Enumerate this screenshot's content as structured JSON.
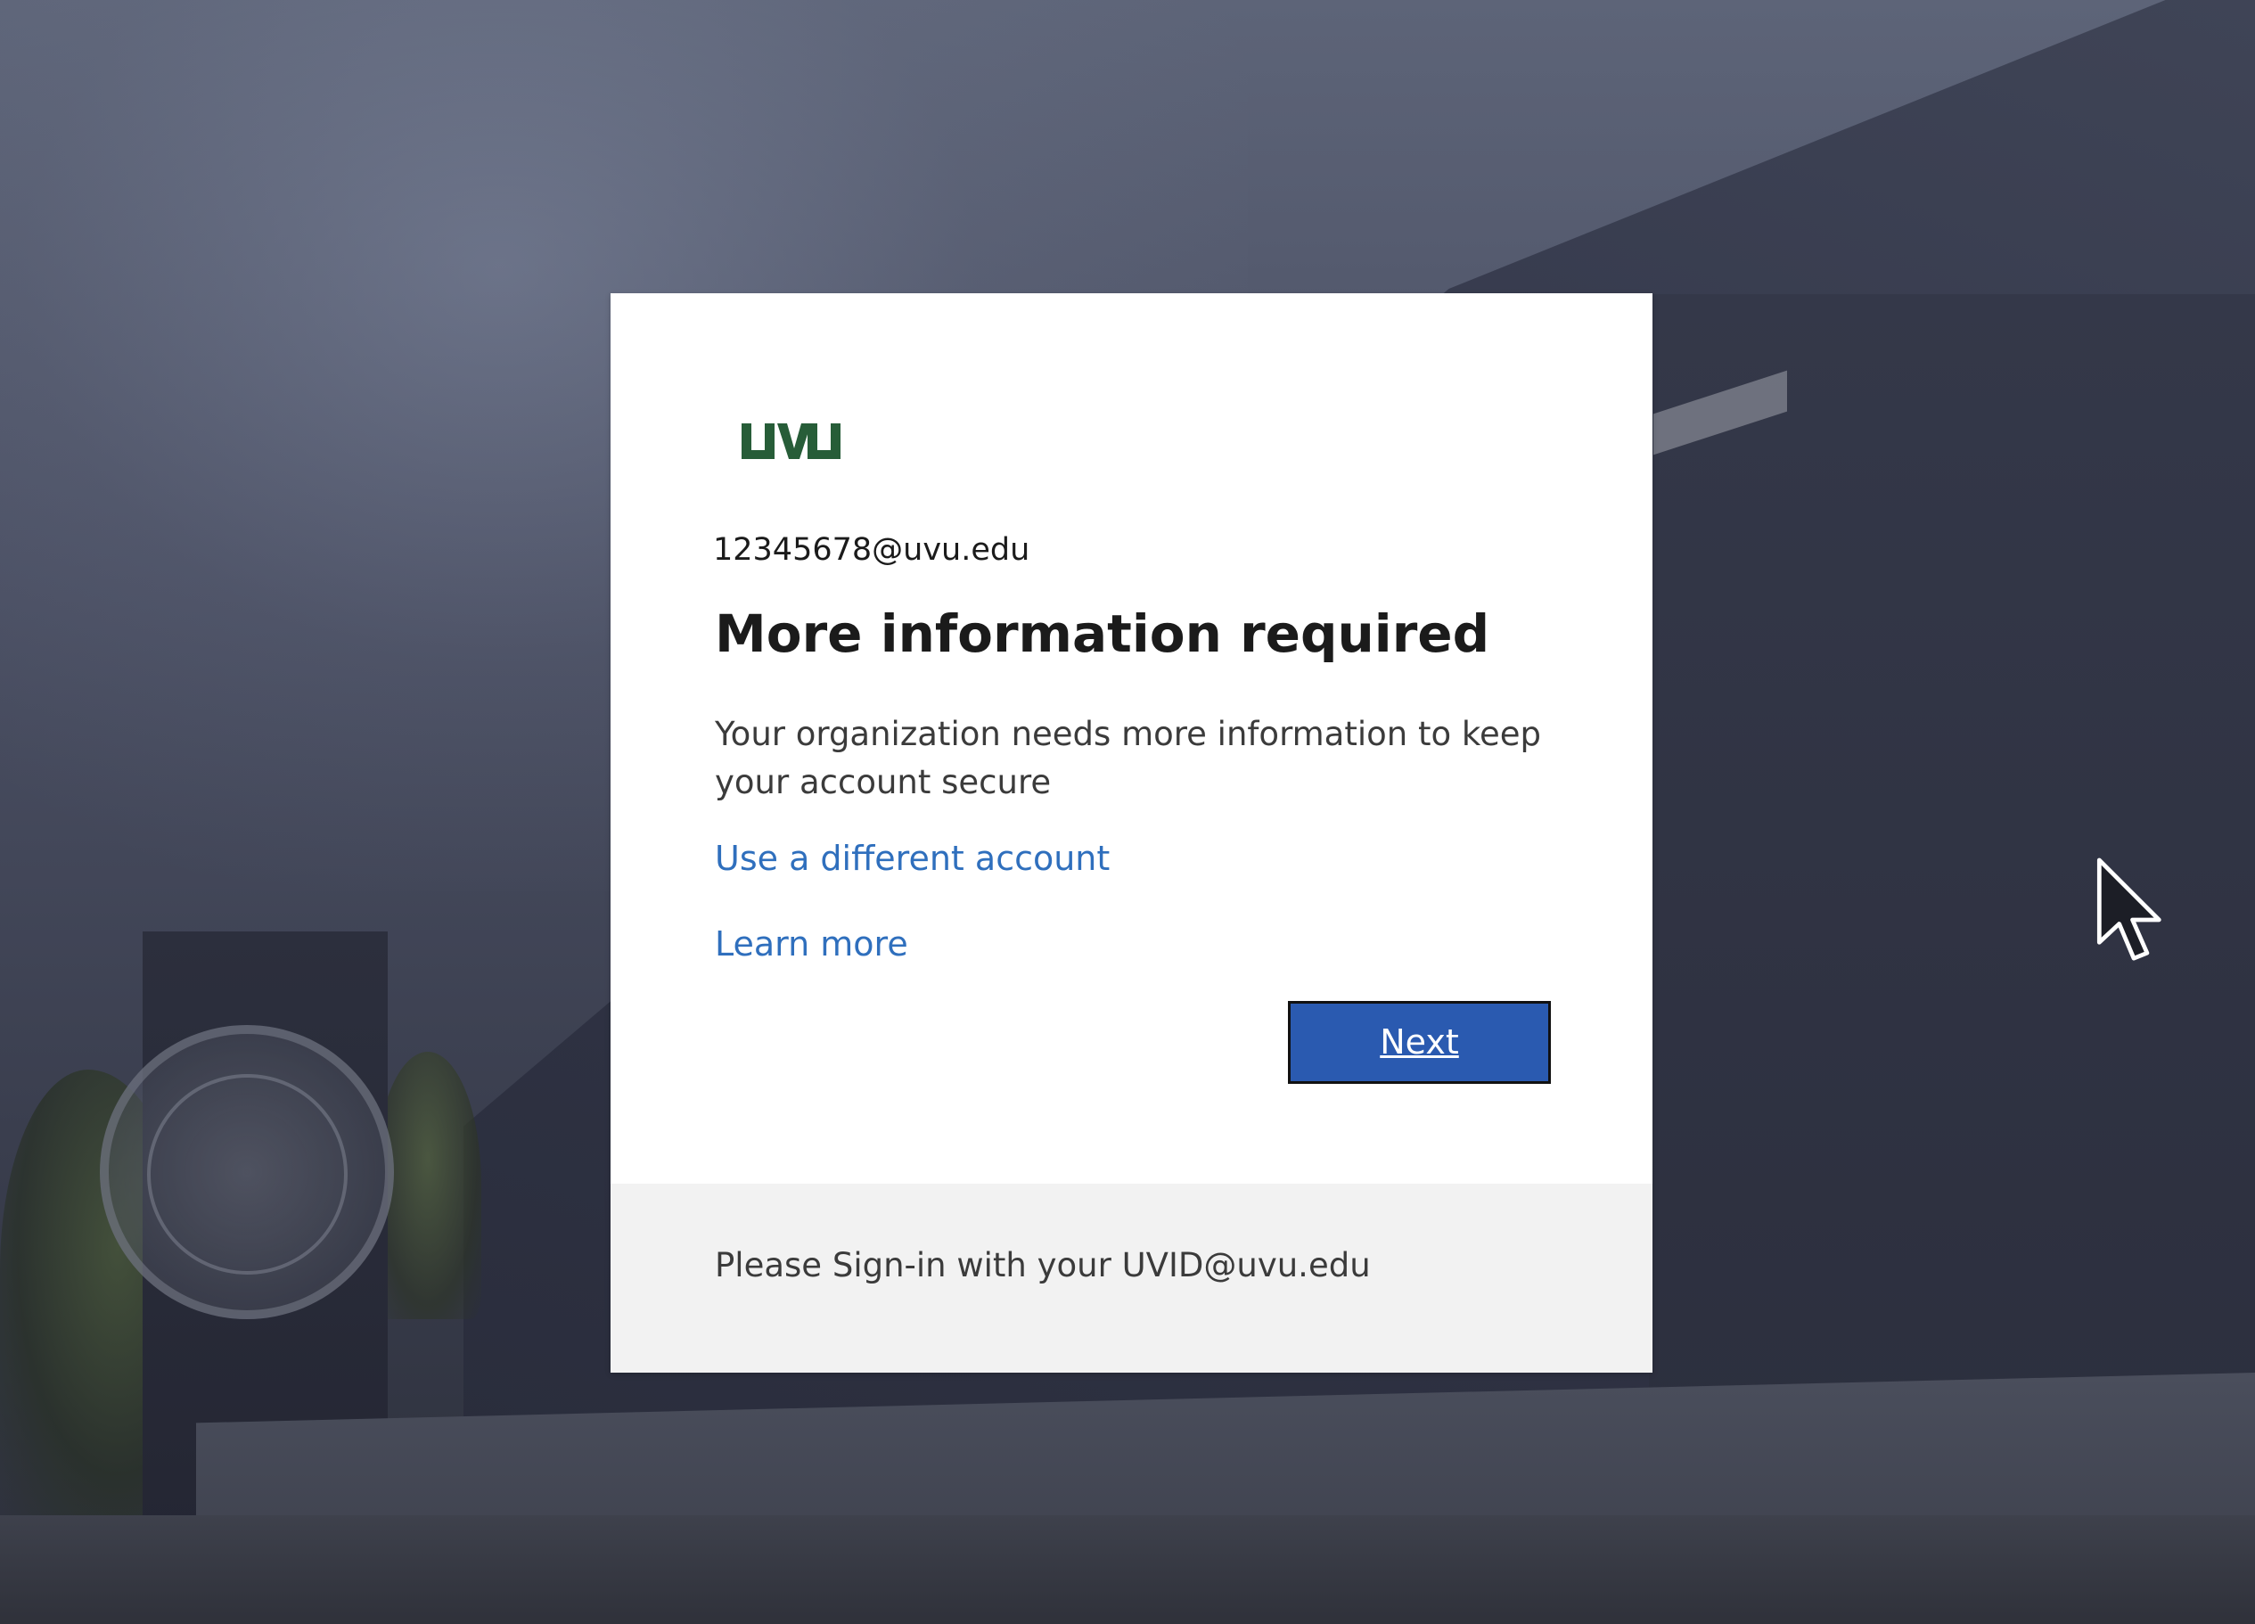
{
  "logo": {
    "text": "UVU",
    "color": "#275d38"
  },
  "account": {
    "email": "12345678@uvu.edu"
  },
  "page": {
    "title": "More information required",
    "description": "Your organization needs more information to keep your account secure"
  },
  "links": {
    "different_account": "Use a different account",
    "learn_more": "Learn more"
  },
  "actions": {
    "next_label": "Next"
  },
  "footer": {
    "text": "Please Sign-in with your UVID@uvu.edu"
  },
  "colors": {
    "link": "#2f6fbd",
    "button_bg": "#2a5ab0",
    "footer_bg": "#f2f2f2",
    "logo": "#275d38"
  },
  "icons": {
    "cursor": "mouse-pointer-icon",
    "logo": "uvu-logo"
  }
}
